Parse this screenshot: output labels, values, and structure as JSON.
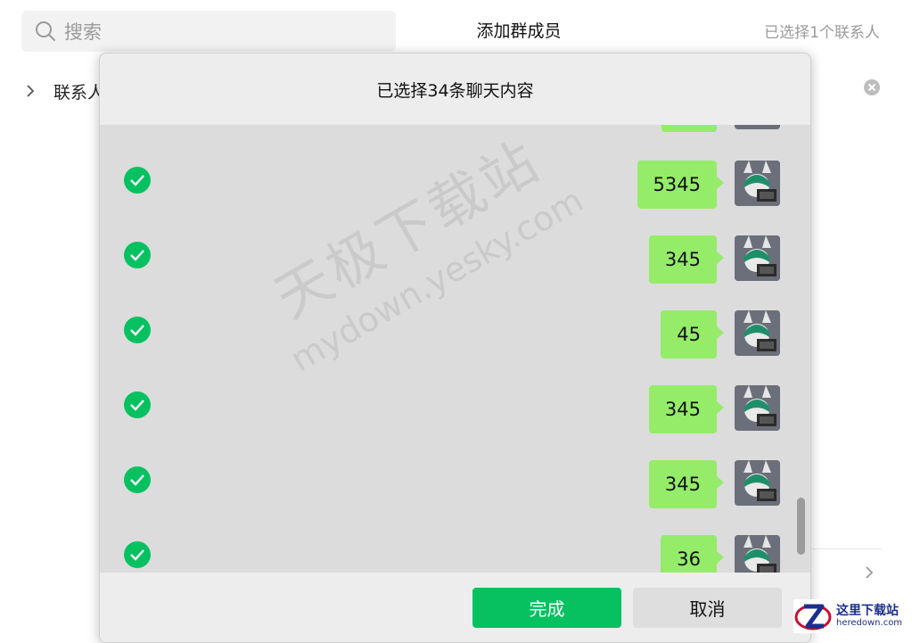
{
  "background": {
    "search_placeholder": "搜索",
    "title": "添加群成员",
    "selected_count": "已选择1个联系人",
    "contacts_label": "联系人"
  },
  "dialog": {
    "title": "已选择34条聊天内容",
    "messages": [
      {
        "text": "",
        "checked": true
      },
      {
        "text": "5345",
        "checked": true
      },
      {
        "text": "345",
        "checked": true
      },
      {
        "text": "45",
        "checked": true
      },
      {
        "text": "345",
        "checked": true
      },
      {
        "text": "345",
        "checked": true
      },
      {
        "text": "36",
        "checked": true
      }
    ],
    "done_label": "完成",
    "cancel_label": "取消"
  },
  "watermark": {
    "cn": "天极下载站",
    "en": "mydown.yesky.com"
  },
  "site_logo": {
    "cn": "这里下载站",
    "en": "heredown.com"
  },
  "colors": {
    "accent_green": "#07c160",
    "bubble_green": "#95ec69",
    "check_green": "#07c160"
  }
}
